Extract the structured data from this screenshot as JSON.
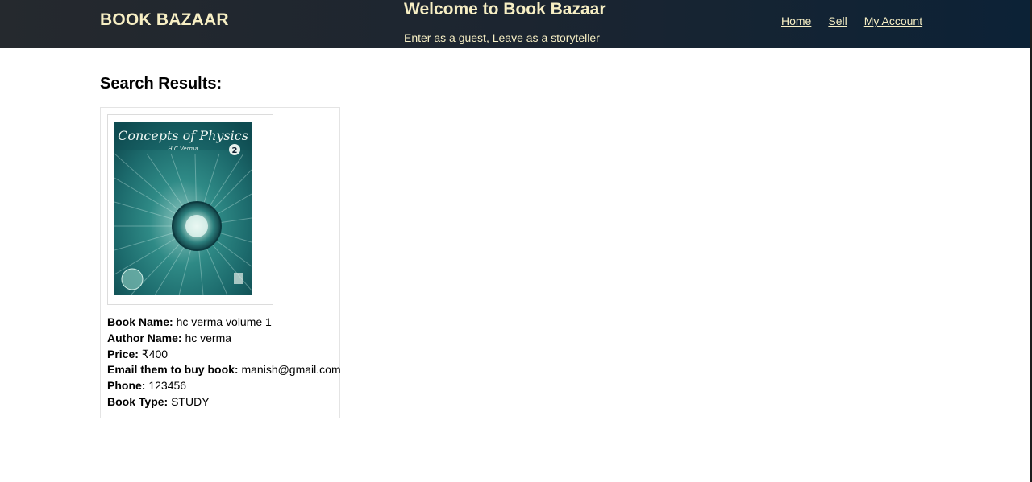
{
  "header": {
    "brand": "BOOK BAZAAR",
    "welcome_title": "Welcome to Book Bazaar",
    "welcome_subtitle": "Enter as a guest, Leave as a storyteller",
    "nav": {
      "home": "Home",
      "sell": "Sell",
      "account": "My Account"
    }
  },
  "main": {
    "results_title": "Search Results:",
    "books": [
      {
        "cover": {
          "title": "Concepts of Physics",
          "author": "H C Verma",
          "volume": "2"
        },
        "fields": [
          {
            "label": "Book Name:",
            "value": "hc verma volume 1"
          },
          {
            "label": "Author Name:",
            "value": "hc verma"
          },
          {
            "label": "Price:",
            "value": "₹400"
          },
          {
            "label": "Email them to buy book:",
            "value": "manish@gmail.com"
          },
          {
            "label": "Phone:",
            "value": "123456"
          },
          {
            "label": "Book Type:",
            "value": "STUDY"
          }
        ]
      }
    ]
  },
  "colors": {
    "header_text": "#f7efc4",
    "header_bg_left": "#25292e",
    "header_bg_right": "#0c2236",
    "card_border": "#e4e4e4"
  }
}
